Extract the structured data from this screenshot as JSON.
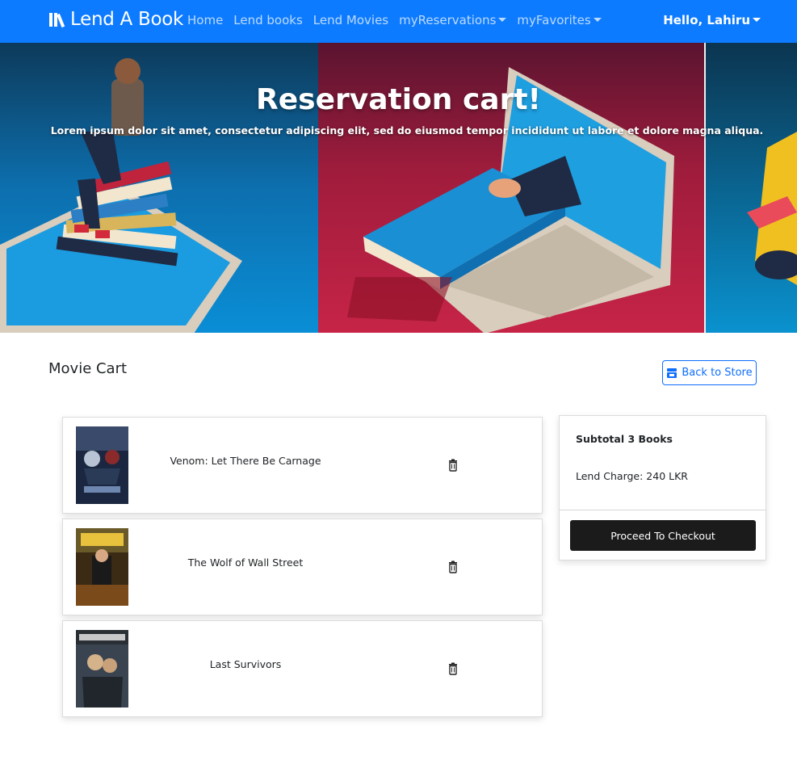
{
  "navbar": {
    "brand": "Lend A Book",
    "links": [
      {
        "label": "Home"
      },
      {
        "label": "Lend books"
      },
      {
        "label": "Lend Movies"
      },
      {
        "label": "myReservations"
      },
      {
        "label": "myFavorites"
      }
    ],
    "user_greeting": "Hello, Lahiru"
  },
  "hero": {
    "title": "Reservation cart!",
    "subtitle": "Lorem ipsum dolor sit amet, consectetur adipiscing elit, sed do eiusmod tempor incididunt ut labore et dolore magna aliqua."
  },
  "cart": {
    "title": "Movie Cart",
    "back_button": "Back to Store",
    "items": [
      {
        "title": "Venom: Let There Be Carnage",
        "poster_icon": "venom-poster"
      },
      {
        "title": "The Wolf of Wall Street",
        "poster_icon": "wolf-poster"
      },
      {
        "title": "Last Survivors",
        "poster_icon": "survivors-poster"
      }
    ]
  },
  "summary": {
    "subtotal": "Subtotal 3 Books",
    "charge": "Lend Charge: 240 LKR",
    "checkout_button": "Proceed To Checkout"
  },
  "colors": {
    "navbar": "#0d7bff",
    "accent": "#0d6efd",
    "checkout": "#1b1b1b"
  }
}
